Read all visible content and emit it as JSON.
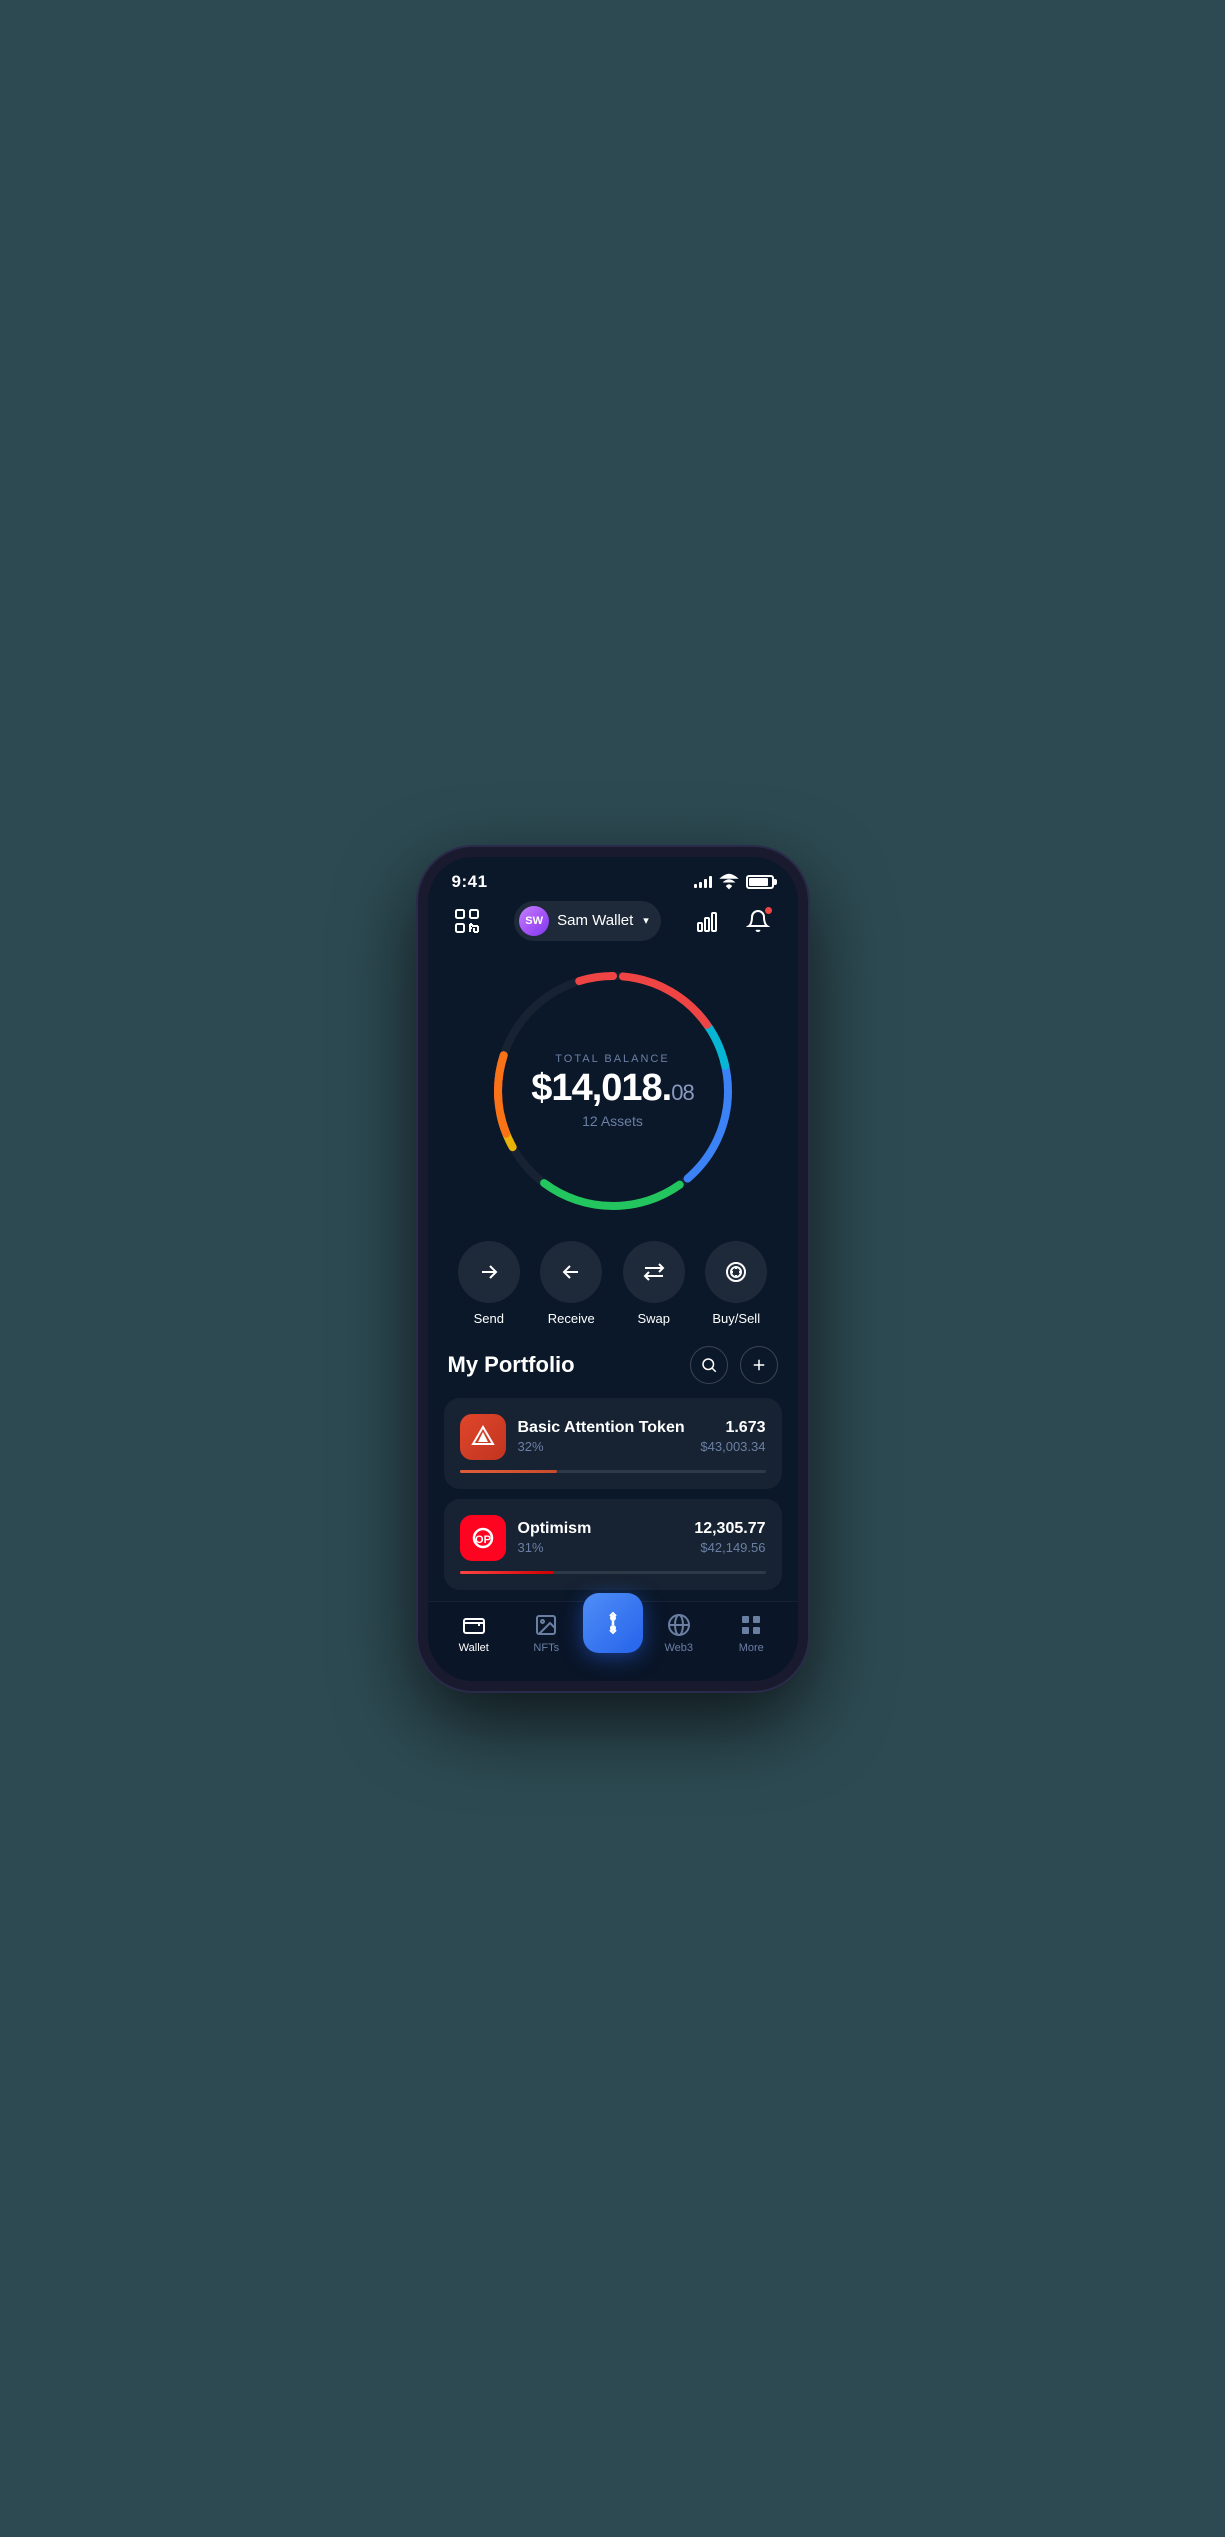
{
  "status": {
    "time": "9:41",
    "signal_bars": [
      4,
      6,
      8,
      10,
      12
    ],
    "battery_level": "90%"
  },
  "header": {
    "wallet_initials": "SW",
    "wallet_name": "Sam Wallet",
    "scan_label": "scan",
    "chart_label": "chart",
    "bell_label": "notifications"
  },
  "balance": {
    "label": "TOTAL BALANCE",
    "main": "$14,018.",
    "cents": "08",
    "assets_count": "12 Assets"
  },
  "actions": [
    {
      "id": "send",
      "label": "Send"
    },
    {
      "id": "receive",
      "label": "Receive"
    },
    {
      "id": "swap",
      "label": "Swap"
    },
    {
      "id": "buysell",
      "label": "Buy/Sell"
    }
  ],
  "portfolio": {
    "title": "My Portfolio",
    "search_label": "search",
    "add_label": "add",
    "assets": [
      {
        "id": "bat",
        "name": "Basic Attention Token",
        "pct": "32%",
        "amount": "1.673",
        "usd": "$43,003.34",
        "bar_width": "32"
      },
      {
        "id": "op",
        "name": "Optimism",
        "pct": "31%",
        "amount": "12,305.77",
        "usd": "$42,149.56",
        "bar_width": "31"
      }
    ]
  },
  "nav": {
    "items": [
      {
        "id": "wallet",
        "label": "Wallet",
        "active": true
      },
      {
        "id": "nfts",
        "label": "NFTs",
        "active": false
      },
      {
        "id": "center",
        "label": "",
        "active": false
      },
      {
        "id": "web3",
        "label": "Web3",
        "active": false
      },
      {
        "id": "more",
        "label": "More",
        "active": false
      }
    ]
  }
}
